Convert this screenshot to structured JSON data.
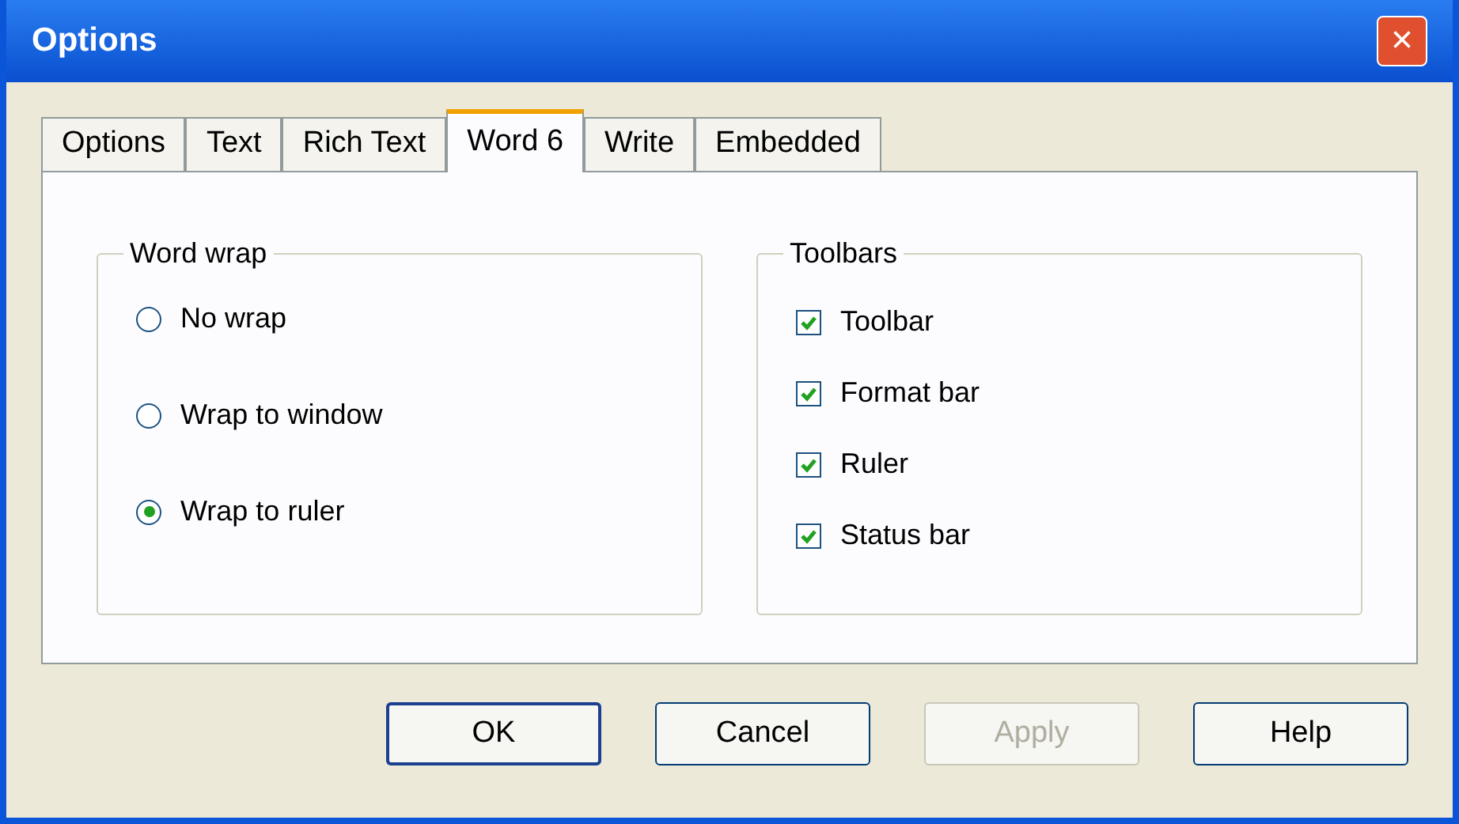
{
  "window": {
    "title": "Options",
    "close": "×"
  },
  "tabs": [
    {
      "label": "Options",
      "selected": false
    },
    {
      "label": "Text",
      "selected": false
    },
    {
      "label": "Rich Text",
      "selected": false
    },
    {
      "label": "Word 6",
      "selected": true
    },
    {
      "label": "Write",
      "selected": false
    },
    {
      "label": "Embedded",
      "selected": false
    }
  ],
  "word_wrap": {
    "title": "Word wrap",
    "options": [
      {
        "label": "No wrap",
        "selected": false
      },
      {
        "label": "Wrap to window",
        "selected": false
      },
      {
        "label": "Wrap to ruler",
        "selected": true
      }
    ]
  },
  "toolbars": {
    "title": "Toolbars",
    "items": [
      {
        "label": "Toolbar",
        "checked": true
      },
      {
        "label": "Format bar",
        "checked": true
      },
      {
        "label": "Ruler",
        "checked": true
      },
      {
        "label": "Status bar",
        "checked": true
      }
    ]
  },
  "buttons": [
    {
      "label": "OK",
      "default": true,
      "disabled": false
    },
    {
      "label": "Cancel",
      "default": false,
      "disabled": false
    },
    {
      "label": "Apply",
      "default": false,
      "disabled": true
    },
    {
      "label": "Help",
      "default": false,
      "disabled": false
    }
  ]
}
